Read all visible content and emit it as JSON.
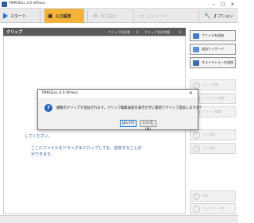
{
  "window": {
    "title": "TMPGEnc 4.0 XPress",
    "minimize": "–",
    "maximize": "□",
    "close": "✕"
  },
  "toolbar": {
    "start": "スタート",
    "input": "入力設定",
    "output_settings": "出力設定",
    "encode": "エンコード",
    "options": "オプション"
  },
  "clip_panel": {
    "title": "クリップ",
    "clip_total_count_label": "クリップ合計数",
    "clip_total_count": "0",
    "clip_total_time_label": "クリップ合計時間",
    "clip_total_time": "0",
    "hint_line1": "してください。",
    "hint_line2": "ここにファイルをドラッグ＆ドロップしても、追加することが",
    "hint_line3": "ができます。"
  },
  "side_buttons": {
    "add_file": "ファイルを追加",
    "add_wizard": "追加ウィザード",
    "add_slideshow": "スライドショーを追加",
    "cut_edit": "カット編集",
    "filter_edit": "フィルター編集",
    "clip_edit": "クリップ編集",
    "move_up": "上に移動",
    "move_down": "下に移動",
    "delete": "削除",
    "filter_list": "フィルター一覧"
  },
  "dialog": {
    "title": "TMPGEnc 4.0 XPress",
    "message": "複数のクリップが追加されます。クリップ編集画面を表示せずに連続でクリップ追加しますか？",
    "yes_label": "はい(Y)",
    "no_label": "いいえ(N)",
    "close": "✕",
    "icon": "question-icon"
  },
  "colors": {
    "accent_orange": "#f3b23a",
    "header_dark": "#5a5a5a",
    "link_blue": "#2f5f9a",
    "icon_blue": "#1f5fbf"
  }
}
